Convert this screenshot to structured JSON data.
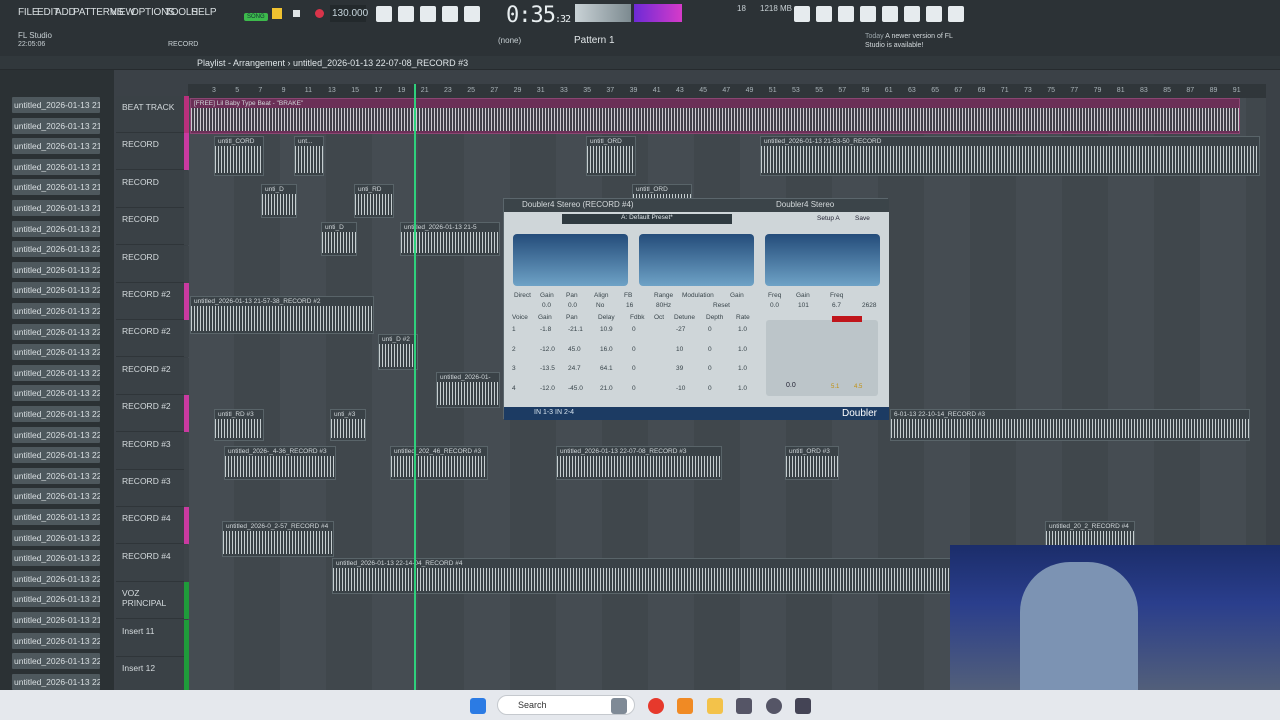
{
  "menubar": {
    "items": [
      "FILE",
      "EDIT",
      "ADD",
      "PATTERNS",
      "VIEW",
      "OPTIONS",
      "TOOLS",
      "HELP"
    ],
    "song_label": "SONG",
    "bpm": "130.000",
    "time": "0:35",
    "time_sub": ":32",
    "cpu": "18",
    "memory": "1218 MB",
    "app_title": "FL Studio",
    "app_time": "22:05:06",
    "record_label": "RECORD",
    "pattern_label": "Pattern 1",
    "none_label": "(none)",
    "notif_today": "Today",
    "notif_text": "A newer version of FL Studio is available!"
  },
  "playlist": {
    "title": "Playlist - Arrangement",
    "file": "untitled_2026-01-13 22-07-08_RECORD #3",
    "ruler": [
      "3",
      "5",
      "7",
      "9",
      "11",
      "13",
      "15",
      "17",
      "19",
      "21",
      "23",
      "25",
      "27",
      "29",
      "31",
      "33",
      "35",
      "37",
      "39",
      "41",
      "43",
      "45",
      "47",
      "49",
      "51",
      "53",
      "55",
      "57",
      "59",
      "61",
      "63",
      "65",
      "67",
      "69",
      "71",
      "73",
      "75",
      "77",
      "79",
      "81",
      "83",
      "85",
      "87",
      "89",
      "91"
    ]
  },
  "browser": {
    "items": [
      "untitled_2026-01-13 21-",
      "untitled_2026-01-13 21-",
      "untitled_2026-01-13 21-",
      "untitled_2026-01-13 21-",
      "untitled_2026-01-13 21-",
      "untitled_2026-01-13 21-",
      "untitled_2026-01-13 21-",
      "untitled_2026-01-13 22-",
      "untitled_2026-01-13 22-",
      "untitled_2026-01-13 22-",
      "untitled_2026-01-13 22-",
      "untitled_2026-01-13 22-",
      "untitled_2026-01-13 22-",
      "untitled_2026-01-13 22-",
      "untitled_2026-01-13 22-",
      "untitled_2026-01-13 22-",
      "untitled_2026-01-13 22-",
      "untitled_2026-01-13 22-",
      "untitled_2026-01-13 22-",
      "untitled_2026-01-13 22-",
      "untitled_2026-01-13 22-",
      "untitled_2026-01-13 22-",
      "untitled_2026-01-13 22-",
      "untitled_2026-01-13 22-",
      "untitled_2026-01-13 21-",
      "untitled_2026-01-13 21-",
      "untitled_2026-01-13 22-",
      "untitled_2026-01-13 22-",
      "untitled_2026-01-13 22-"
    ]
  },
  "tracks": [
    {
      "name": "BEAT TRACK",
      "color": "#b8307c"
    },
    {
      "name": "RECORD",
      "color": "#c93aa0"
    },
    {
      "name": "RECORD",
      "color": "#3d4449"
    },
    {
      "name": "RECORD",
      "color": "#3d4449"
    },
    {
      "name": "RECORD",
      "color": "#3d4449"
    },
    {
      "name": "RECORD #2",
      "color": "#c93aa0"
    },
    {
      "name": "RECORD #2",
      "color": "#3d4449"
    },
    {
      "name": "RECORD #2",
      "color": "#3d4449"
    },
    {
      "name": "RECORD #2",
      "color": "#c93aa0"
    },
    {
      "name": "RECORD #3",
      "color": "#3d4449"
    },
    {
      "name": "RECORD #3",
      "color": "#3d4449"
    },
    {
      "name": "RECORD #4",
      "color": "#c93aa0"
    },
    {
      "name": "RECORD #4",
      "color": "#3d4449"
    },
    {
      "name": "VOZ PRINCIPAL",
      "color": "#1f9b3a"
    },
    {
      "name": "Insert 11",
      "color": "#1f9b3a"
    },
    {
      "name": "Insert 12",
      "color": "#1f9b3a"
    }
  ],
  "clips": [
    {
      "label": "[FREE] Lil Baby Type Beat - \"BRAKE\""
    },
    {
      "label": "untitl_CORD"
    },
    {
      "label": "unt..."
    },
    {
      "label": "untitl_ORD"
    },
    {
      "label": "untitled_2026-01-13 21-53-50_RECORD"
    },
    {
      "label": "unti_D"
    },
    {
      "label": "unti_RD"
    },
    {
      "label": "untitl_ORD"
    },
    {
      "label": "unti_D"
    },
    {
      "label": "untitled_2026-01-13 21-5"
    },
    {
      "label": "untitled_2026-01-13 21-57-38_RECORD #2"
    },
    {
      "label": "unti_D #2"
    },
    {
      "label": "untitled_2026-01-"
    },
    {
      "label": "untitl_RD #3"
    },
    {
      "label": "unti_#3"
    },
    {
      "label": "untitled_2026-_4-36_RECORD #3"
    },
    {
      "label": "untitled_202_46_RECORD #3"
    },
    {
      "label": "untitled_2026-01-13 22-07-08_RECORD #3"
    },
    {
      "label": "untitl_ORD #3"
    },
    {
      "label": "6-01-13 22-10-14_RECORD #3"
    },
    {
      "label": "untitled_2026-0_2-57_RECORD #4"
    },
    {
      "label": "untitled_2026-01-13 22-14-04_RECORD #4"
    },
    {
      "label": "untitled_20_2_RECORD #4"
    }
  ],
  "plugin": {
    "title": "Doubler4 Stereo (RECORD #4)",
    "title2": "Doubler4 Stereo",
    "preset": "A: Default Preset*",
    "setup": "Setup A",
    "save": "Save",
    "headers": [
      "Direct",
      "Gain",
      "Pan",
      "Align",
      "FB",
      "Range",
      "Modulation",
      "Gain",
      "Freq",
      "Gain",
      "Freq"
    ],
    "top_values": [
      "0.0",
      "0.0",
      "No",
      "16",
      "80Hz",
      "Reset",
      "0.0",
      "101",
      "6.7",
      "2628"
    ],
    "voice_headers": [
      "Voice",
      "Gain",
      "Pan",
      "Delay",
      "Fdbk",
      "Oct",
      "Detune",
      "Depth",
      "Rate"
    ],
    "voices": [
      [
        "1",
        "-1.8",
        "-21.1",
        "10.9",
        "0",
        "",
        "-27",
        "0",
        "1.0"
      ],
      [
        "2",
        "-12.0",
        "45.0",
        "16.0",
        "0",
        "",
        "10",
        "0",
        "1.0"
      ],
      [
        "3",
        "-13.5",
        "24.7",
        "64.1",
        "0",
        "",
        "39",
        "0",
        "1.0"
      ],
      [
        "4",
        "-12.0",
        "-45.0",
        "21.0",
        "0",
        "",
        "-10",
        "0",
        "1.0"
      ]
    ],
    "master_gain": "0.0",
    "meter_l": "5.1",
    "meter_r": "4.5",
    "footer": "IN 1-3   IN 2-4",
    "logo": "Doubler",
    "accent": "#1c3b63"
  },
  "taskbar": {
    "search": "Search"
  }
}
